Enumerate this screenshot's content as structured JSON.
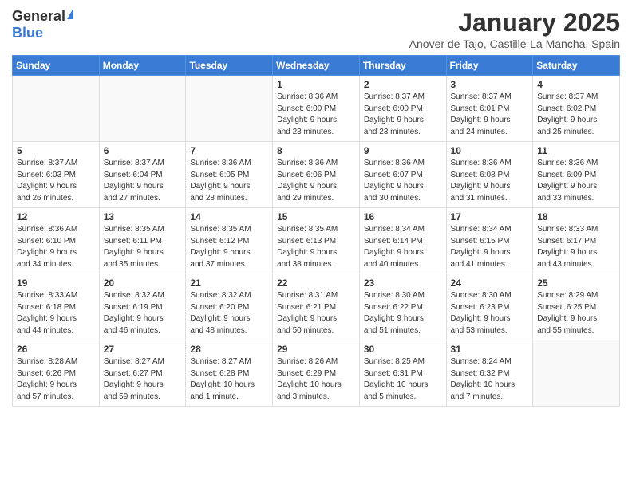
{
  "logo": {
    "general": "General",
    "blue": "Blue"
  },
  "title": "January 2025",
  "subtitle": "Anover de Tajo, Castille-La Mancha, Spain",
  "days_of_week": [
    "Sunday",
    "Monday",
    "Tuesday",
    "Wednesday",
    "Thursday",
    "Friday",
    "Saturday"
  ],
  "weeks": [
    [
      {
        "day": "",
        "info": ""
      },
      {
        "day": "",
        "info": ""
      },
      {
        "day": "",
        "info": ""
      },
      {
        "day": "1",
        "info": "Sunrise: 8:36 AM\nSunset: 6:00 PM\nDaylight: 9 hours\nand 23 minutes."
      },
      {
        "day": "2",
        "info": "Sunrise: 8:37 AM\nSunset: 6:00 PM\nDaylight: 9 hours\nand 23 minutes."
      },
      {
        "day": "3",
        "info": "Sunrise: 8:37 AM\nSunset: 6:01 PM\nDaylight: 9 hours\nand 24 minutes."
      },
      {
        "day": "4",
        "info": "Sunrise: 8:37 AM\nSunset: 6:02 PM\nDaylight: 9 hours\nand 25 minutes."
      }
    ],
    [
      {
        "day": "5",
        "info": "Sunrise: 8:37 AM\nSunset: 6:03 PM\nDaylight: 9 hours\nand 26 minutes."
      },
      {
        "day": "6",
        "info": "Sunrise: 8:37 AM\nSunset: 6:04 PM\nDaylight: 9 hours\nand 27 minutes."
      },
      {
        "day": "7",
        "info": "Sunrise: 8:36 AM\nSunset: 6:05 PM\nDaylight: 9 hours\nand 28 minutes."
      },
      {
        "day": "8",
        "info": "Sunrise: 8:36 AM\nSunset: 6:06 PM\nDaylight: 9 hours\nand 29 minutes."
      },
      {
        "day": "9",
        "info": "Sunrise: 8:36 AM\nSunset: 6:07 PM\nDaylight: 9 hours\nand 30 minutes."
      },
      {
        "day": "10",
        "info": "Sunrise: 8:36 AM\nSunset: 6:08 PM\nDaylight: 9 hours\nand 31 minutes."
      },
      {
        "day": "11",
        "info": "Sunrise: 8:36 AM\nSunset: 6:09 PM\nDaylight: 9 hours\nand 33 minutes."
      }
    ],
    [
      {
        "day": "12",
        "info": "Sunrise: 8:36 AM\nSunset: 6:10 PM\nDaylight: 9 hours\nand 34 minutes."
      },
      {
        "day": "13",
        "info": "Sunrise: 8:35 AM\nSunset: 6:11 PM\nDaylight: 9 hours\nand 35 minutes."
      },
      {
        "day": "14",
        "info": "Sunrise: 8:35 AM\nSunset: 6:12 PM\nDaylight: 9 hours\nand 37 minutes."
      },
      {
        "day": "15",
        "info": "Sunrise: 8:35 AM\nSunset: 6:13 PM\nDaylight: 9 hours\nand 38 minutes."
      },
      {
        "day": "16",
        "info": "Sunrise: 8:34 AM\nSunset: 6:14 PM\nDaylight: 9 hours\nand 40 minutes."
      },
      {
        "day": "17",
        "info": "Sunrise: 8:34 AM\nSunset: 6:15 PM\nDaylight: 9 hours\nand 41 minutes."
      },
      {
        "day": "18",
        "info": "Sunrise: 8:33 AM\nSunset: 6:17 PM\nDaylight: 9 hours\nand 43 minutes."
      }
    ],
    [
      {
        "day": "19",
        "info": "Sunrise: 8:33 AM\nSunset: 6:18 PM\nDaylight: 9 hours\nand 44 minutes."
      },
      {
        "day": "20",
        "info": "Sunrise: 8:32 AM\nSunset: 6:19 PM\nDaylight: 9 hours\nand 46 minutes."
      },
      {
        "day": "21",
        "info": "Sunrise: 8:32 AM\nSunset: 6:20 PM\nDaylight: 9 hours\nand 48 minutes."
      },
      {
        "day": "22",
        "info": "Sunrise: 8:31 AM\nSunset: 6:21 PM\nDaylight: 9 hours\nand 50 minutes."
      },
      {
        "day": "23",
        "info": "Sunrise: 8:30 AM\nSunset: 6:22 PM\nDaylight: 9 hours\nand 51 minutes."
      },
      {
        "day": "24",
        "info": "Sunrise: 8:30 AM\nSunset: 6:23 PM\nDaylight: 9 hours\nand 53 minutes."
      },
      {
        "day": "25",
        "info": "Sunrise: 8:29 AM\nSunset: 6:25 PM\nDaylight: 9 hours\nand 55 minutes."
      }
    ],
    [
      {
        "day": "26",
        "info": "Sunrise: 8:28 AM\nSunset: 6:26 PM\nDaylight: 9 hours\nand 57 minutes."
      },
      {
        "day": "27",
        "info": "Sunrise: 8:27 AM\nSunset: 6:27 PM\nDaylight: 9 hours\nand 59 minutes."
      },
      {
        "day": "28",
        "info": "Sunrise: 8:27 AM\nSunset: 6:28 PM\nDaylight: 10 hours\nand 1 minute."
      },
      {
        "day": "29",
        "info": "Sunrise: 8:26 AM\nSunset: 6:29 PM\nDaylight: 10 hours\nand 3 minutes."
      },
      {
        "day": "30",
        "info": "Sunrise: 8:25 AM\nSunset: 6:31 PM\nDaylight: 10 hours\nand 5 minutes."
      },
      {
        "day": "31",
        "info": "Sunrise: 8:24 AM\nSunset: 6:32 PM\nDaylight: 10 hours\nand 7 minutes."
      },
      {
        "day": "",
        "info": ""
      }
    ]
  ]
}
